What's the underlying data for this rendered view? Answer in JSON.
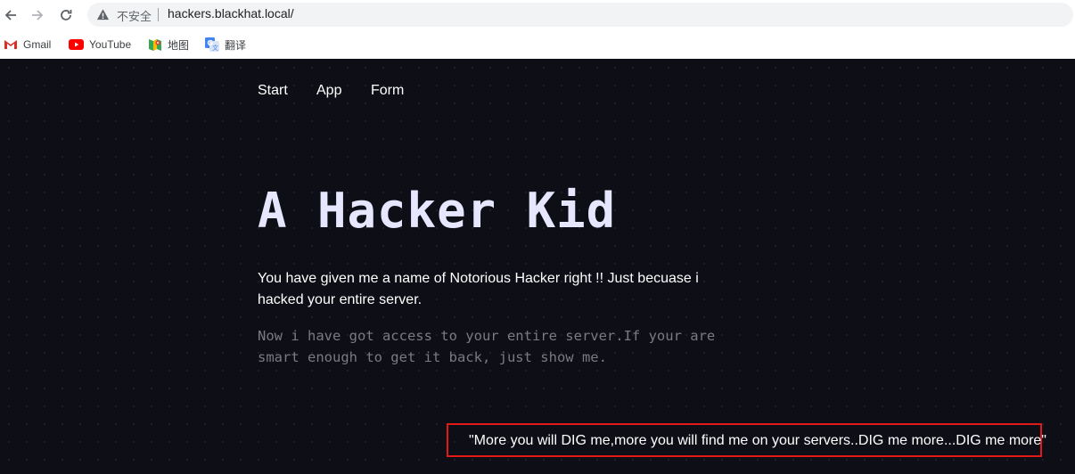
{
  "browser": {
    "security_label": "不安全",
    "url": "hackers.blackhat.local/",
    "bookmarks": [
      {
        "label": "Gmail",
        "icon": "gmail-icon"
      },
      {
        "label": "YouTube",
        "icon": "youtube-icon"
      },
      {
        "label": "地图",
        "icon": "maps-icon"
      },
      {
        "label": "翻译",
        "icon": "translate-icon"
      }
    ]
  },
  "page": {
    "nav": [
      "Start",
      "App",
      "Form"
    ],
    "title": "A Hacker Kid",
    "lead": "You have given me a name of Notorious Hacker right !! Just becuase i hacked your entire server.",
    "note": "Now i have got access to your entire server.If your are smart enough to get it back, just show me.",
    "hint": "\"More you will DIG me,more you will find me on your servers..DIG me more...DIG me more\""
  },
  "colors": {
    "page_bg": "#0e0e16",
    "title": "#e7e6ff",
    "note_text": "#7a7a80",
    "highlight_border": "#e11919"
  }
}
